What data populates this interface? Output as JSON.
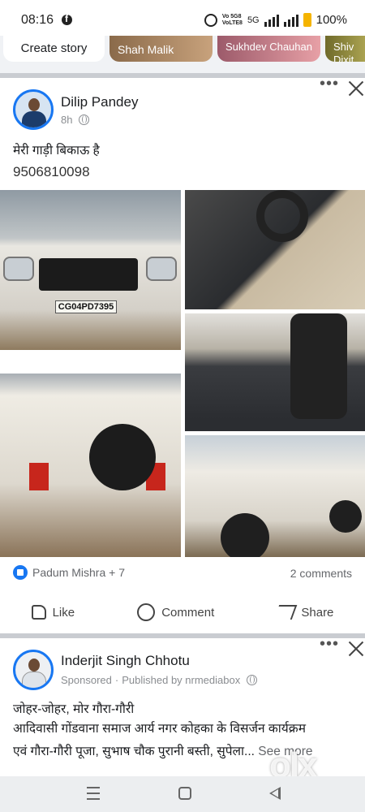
{
  "status_bar": {
    "time": "08:16",
    "network_top": "Vo 5G8",
    "network_bottom": "VoLTE8",
    "signal_label": "5G",
    "battery": "100%"
  },
  "stories": [
    {
      "label": "Create story"
    },
    {
      "label": "Shah Malik"
    },
    {
      "label": "Sukhdev Chauhan"
    },
    {
      "label": "Shiv Dixit"
    }
  ],
  "post1": {
    "author": "Dilip Pandey",
    "time": "8h",
    "text": "मेरी गाड़ी बिकाऊ है",
    "phone": "9506810098",
    "plate": "CG04PD7395",
    "reactions": "Padum Mishra + 7",
    "comments": "2 comments",
    "actions": {
      "like": "Like",
      "comment": "Comment",
      "share": "Share"
    }
  },
  "post2": {
    "author": "Inderjit Singh Chhotu",
    "sponsored": "Sponsored",
    "published_by": "Published by nrmediabox",
    "line1": "जोहर-जोहर, मोर गौरा-गौरी",
    "line2": "आदिवासी गोंडवाना समाज आर्य नगर कोहका के विसर्जन कार्यक्रम",
    "line3": "एवं गौरा-गौरी पूजा, सुभाष चौक पुरानी बस्ती, सुपेला...",
    "see_more": "See more"
  },
  "watermark": "olx",
  "colors": {
    "fb_blue": "#1877f2",
    "separator": "#c9ccd1",
    "meta_gray": "#65676b"
  }
}
